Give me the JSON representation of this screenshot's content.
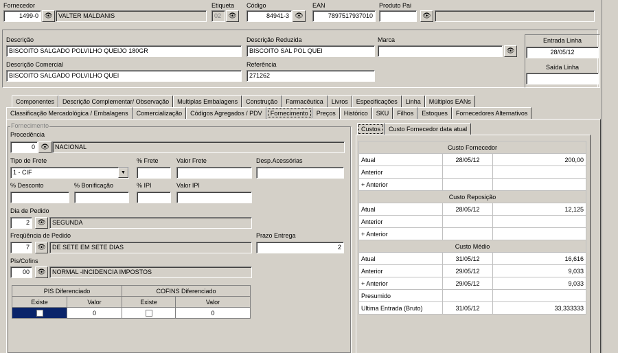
{
  "top": {
    "fornecedor_label": "Fornecedor",
    "fornecedor_code": "1499-0",
    "fornecedor_name": "VALTER MALDANIS",
    "etiqueta_label": "Etiqueta",
    "etiqueta_value": "02",
    "codigo_label": "Código",
    "codigo_value": "84941-3",
    "ean_label": "EAN",
    "ean_value": "7897517937010",
    "produto_pai_label": "Produto Pai"
  },
  "product": {
    "descricao_label": "Descrição",
    "descricao_value": "BISCOITO SALGADO POLVILHO QUEIJO 180GR",
    "desc_reduzida_label": "Descrição Reduzida",
    "desc_reduzida_value": "BISCOITO SAL POL QUEI",
    "marca_label": "Marca",
    "desc_comercial_label": "Descrição Comercial",
    "desc_comercial_value": "BISCOITO SALGADO POLVILHO QUEI",
    "referencia_label": "Referência",
    "referencia_value": "271262",
    "entrada_linha_label": "Entrada Linha",
    "entrada_linha_value": "28/05/12",
    "saida_linha_label": "Saída Linha"
  },
  "tabs_row1": [
    "Componentes",
    "Descrição Complementar/ Observação",
    "Multiplas Embalagens",
    "Construção",
    "Farmacêutica",
    "Livros",
    "Especificações",
    "Linha",
    "Múltiplos EANs"
  ],
  "tabs_row2": [
    "Classificação Mercadológica / Embalagens",
    "Comercialização",
    "Códigos Agregados / PDV",
    "Fornecimento",
    "Preços",
    "Histórico",
    "SKU",
    "Filhos",
    "Estoques",
    "Fornecedores Alternativos"
  ],
  "fornecimento": {
    "group_label": "Fornecimento",
    "procedencia_label": "Procedência",
    "procedencia_code": "0",
    "procedencia_name": "NACIONAL",
    "tipo_frete_label": "Tipo de Frete",
    "tipo_frete_value": "1 - CIF",
    "pct_frete_label": "% Frete",
    "valor_frete_label": "Valor Frete",
    "desp_acessorias_label": "Desp.Acessórias",
    "pct_desconto_label": "% Desconto",
    "pct_bonificacao_label": "% Bonificação",
    "pct_ipi_label": "% IPI",
    "valor_ipi_label": "Valor IPI",
    "dia_pedido_label": "Dia de Pedido",
    "dia_pedido_code": "2",
    "dia_pedido_name": "SEGUNDA",
    "frequencia_label": "Freqüência de Pedido",
    "frequencia_code": "7",
    "frequencia_name": "DE SETE EM SETE DIAS",
    "prazo_label": "Prazo Entrega",
    "prazo_value": "2",
    "pis_cofins_label": "Pis/Cofins",
    "pis_cofins_code": "00",
    "pis_cofins_name": "NORMAL -INCIDENCIA IMPOSTOS",
    "pis_dif_label": "PIS Diferenciado",
    "cofins_dif_label": "COFINS Diferenciado",
    "existe_label": "Existe",
    "valor_label": "Valor",
    "pis_valor": "0",
    "cofins_valor": "0"
  },
  "costs": {
    "tab1": "Custos",
    "tab2": "Custo Fornecedor data atual",
    "fornecedor_header": "Custo Fornecedor",
    "reposicao_header": "Custo Reposição",
    "medio_header": "Custo Médio",
    "rows_fornecedor": [
      {
        "label": "Atual",
        "date": "28/05/12",
        "value": "200,00"
      },
      {
        "label": "Anterior",
        "date": "",
        "value": ""
      },
      {
        "label": "+ Anterior",
        "date": "",
        "value": ""
      }
    ],
    "rows_reposicao": [
      {
        "label": "Atual",
        "date": "28/05/12",
        "value": "12,125"
      },
      {
        "label": "Anterior",
        "date": "",
        "value": ""
      },
      {
        "label": "+ Anterior",
        "date": "",
        "value": ""
      }
    ],
    "rows_medio": [
      {
        "label": "Atual",
        "date": "31/05/12",
        "value": "16,616"
      },
      {
        "label": "Anterior",
        "date": "29/05/12",
        "value": "9,033"
      },
      {
        "label": "+ Anterior",
        "date": "29/05/12",
        "value": "9,033"
      },
      {
        "label": "Presumido",
        "date": "",
        "value": ""
      },
      {
        "label": "Ultima Entrada (Bruto)",
        "date": "31/05/12",
        "value": "33,333333"
      }
    ]
  }
}
